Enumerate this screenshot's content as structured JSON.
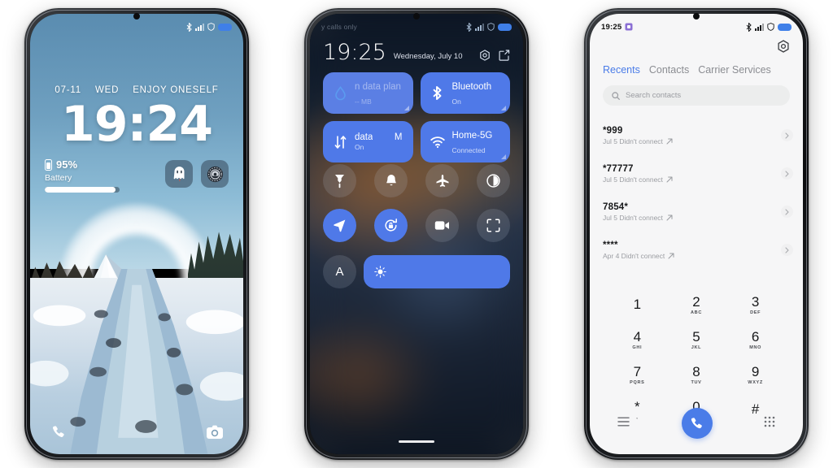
{
  "page": {
    "background": "#ffffff",
    "phone_count": 3
  },
  "accent": {
    "blue": "#4f79e8",
    "tab_blue": "#4a7ce8",
    "lock_sky": "#6fa0c0"
  },
  "phone1": {
    "name": "lock-screen",
    "statusbar": {
      "left_text": "",
      "icons": [
        "bluetooth-icon",
        "signal-icon",
        "shield-icon",
        "battery-icon"
      ]
    },
    "date_row": {
      "date": "07-11",
      "weekday": "WED",
      "motto": "ENJOY ONESELF"
    },
    "clock": "19:24",
    "battery_widget": {
      "percent": "95%",
      "label": "Battery",
      "fill": 95,
      "icon": "phone-battery-icon"
    },
    "shortcuts": [
      {
        "name": "shortcut-ghost",
        "icon": "ghost-icon"
      },
      {
        "name": "shortcut-compass",
        "icon": "compass-gear-icon"
      }
    ],
    "bottom_actions": [
      {
        "name": "phone-shortcut",
        "icon": "phone-icon"
      },
      {
        "name": "camera-shortcut",
        "icon": "camera-icon"
      }
    ]
  },
  "phone2": {
    "name": "control-center",
    "statusbar": {
      "left_text": "y calls only",
      "icons": [
        "bluetooth-icon",
        "signal-icon",
        "shield-icon",
        "battery-icon"
      ]
    },
    "clock": "19:25",
    "date": "Wednesday, July 10",
    "header_icons": [
      {
        "name": "settings-gear-icon",
        "icon": "gear-octagon-icon"
      },
      {
        "name": "edit-icon",
        "icon": "pencil-square-icon"
      }
    ],
    "tiles": [
      {
        "title": "n data plan",
        "subtitle": "-- MB",
        "icon": "data-drop-icon",
        "state": "faded",
        "resize": true
      },
      {
        "title": "Bluetooth",
        "subtitle": "On",
        "icon": "bluetooth-icon",
        "state": "on",
        "resize": true
      },
      {
        "title": "data",
        "title_extra": "M",
        "subtitle": "On",
        "icon": "data-arrows-icon",
        "state": "on",
        "resize": false
      },
      {
        "title": "Home-5G",
        "subtitle": "Connected",
        "icon": "wifi-icon",
        "state": "on",
        "resize": true
      }
    ],
    "toggle_row_1": [
      {
        "name": "flashlight-toggle",
        "icon": "flashlight-icon",
        "on": false
      },
      {
        "name": "sound-toggle",
        "icon": "bell-icon",
        "on": false
      },
      {
        "name": "airplane-toggle",
        "icon": "airplane-icon",
        "on": false
      },
      {
        "name": "dark-mode-toggle",
        "icon": "contrast-icon",
        "on": false
      }
    ],
    "toggle_row_2": [
      {
        "name": "location-toggle",
        "icon": "location-arrow-icon",
        "on": true
      },
      {
        "name": "auto-rotate-toggle",
        "icon": "rotate-lock-icon",
        "on": true
      },
      {
        "name": "screen-recorder-toggle",
        "icon": "video-camera-icon",
        "on": false
      },
      {
        "name": "screenshot-toggle",
        "icon": "scan-frame-icon",
        "on": false
      }
    ],
    "brightness": {
      "auto_label": "A",
      "icon": "sun-icon",
      "level": 100
    }
  },
  "phone3": {
    "name": "dialer-app",
    "statusbar": {
      "time": "19:25",
      "left_icons": [
        "app-badge-icon"
      ],
      "icons": [
        "bluetooth-icon",
        "signal-icon",
        "shield-icon",
        "battery-icon"
      ]
    },
    "settings_icon": "gear-octagon-icon",
    "tabs": [
      {
        "label": "Recents",
        "active": true
      },
      {
        "label": "Contacts",
        "active": false
      },
      {
        "label": "Carrier Services",
        "active": false
      }
    ],
    "search": {
      "placeholder": "Search contacts",
      "icon": "search-icon"
    },
    "calls": [
      {
        "number": "*999",
        "detail": "Jul 5 Didn't connect",
        "direction": "outgoing-arrow-icon"
      },
      {
        "number": "*77777",
        "detail": "Jul 5 Didn't connect",
        "direction": "outgoing-arrow-icon"
      },
      {
        "number": "7854*",
        "detail": "Jul 5 Didn't connect",
        "direction": "outgoing-arrow-icon"
      },
      {
        "number": "****",
        "detail": "Apr 4 Didn't connect",
        "direction": "outgoing-arrow-icon"
      }
    ],
    "keypad": [
      {
        "digit": "1",
        "letters": ""
      },
      {
        "digit": "2",
        "letters": "ABC"
      },
      {
        "digit": "3",
        "letters": "DEF"
      },
      {
        "digit": "4",
        "letters": "GHI"
      },
      {
        "digit": "5",
        "letters": "JKL"
      },
      {
        "digit": "6",
        "letters": "MNO"
      },
      {
        "digit": "7",
        "letters": "PQRS"
      },
      {
        "digit": "8",
        "letters": "TUV"
      },
      {
        "digit": "9",
        "letters": "WXYZ"
      },
      {
        "digit": "*",
        "letters": ","
      },
      {
        "digit": "0",
        "letters": "+"
      },
      {
        "digit": "#",
        "letters": ""
      }
    ],
    "bottom_bar": [
      {
        "name": "menu-button",
        "icon": "hamburger-icon"
      },
      {
        "name": "call-button",
        "icon": "phone-icon"
      },
      {
        "name": "keypad-button",
        "icon": "dialpad-icon"
      }
    ]
  }
}
